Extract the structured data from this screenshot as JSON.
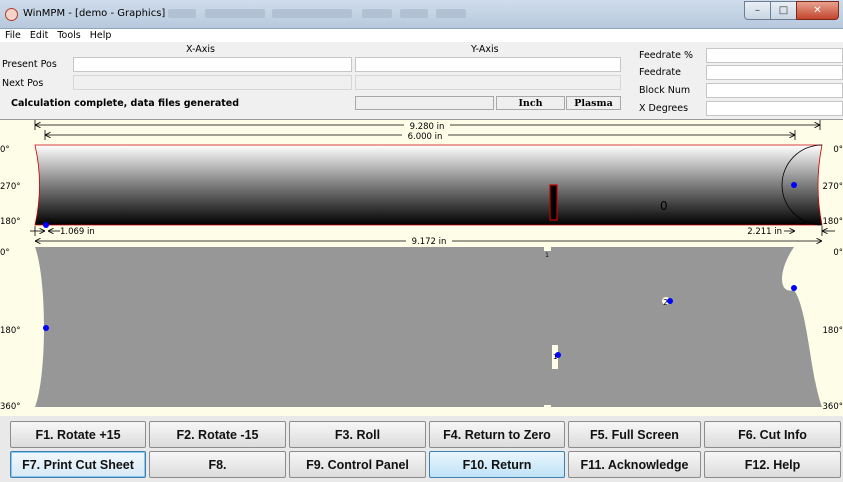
{
  "window": {
    "title": "WinMPM - [demo - Graphics]",
    "icon": "winmpm-app-icon",
    "controls": {
      "minimize": "–",
      "maximize": "□",
      "close": "✕"
    }
  },
  "menu": [
    "File",
    "Edit",
    "Tools",
    "Help"
  ],
  "position_panel": {
    "x_axis_label": "X-Axis",
    "y_axis_label": "Y-Axis",
    "present_pos_label": "Present Pos",
    "next_pos_label": "Next Pos",
    "present_pos_x": "",
    "present_pos_y": "",
    "next_pos_x": "",
    "next_pos_y": ""
  },
  "status": {
    "message": "Calculation complete, data files generated",
    "units": "Inch",
    "process": "Plasma"
  },
  "side_panel": {
    "feedrate_pct_label": "Feedrate %",
    "feedrate_label": "Feedrate",
    "block_num_label": "Block Num",
    "x_degrees_label": "X Degrees",
    "feedrate_pct_value": "",
    "feedrate_value": "",
    "block_num_value": "",
    "x_degrees_value": ""
  },
  "graphics": {
    "dim_overall_top": "9.280 in",
    "dim_length_top": "6.000 in",
    "dim_left_offset": "1.069 in",
    "dim_right_offset": "2.211 in",
    "dim_overall_bottom": "9.172 in",
    "top_view": {
      "angle_0": "0°",
      "angle_270": "270°",
      "angle_180": "180°",
      "angle_0_right": "0°",
      "angle_270_right": "270°",
      "angle_180_right": "180°",
      "hole_label": "0"
    },
    "flat_view": {
      "angle_0": "0°",
      "angle_180": "180°",
      "angle_360": "360°",
      "angle_0_right": "0°",
      "angle_180_right": "180°",
      "angle_360_right": "360°",
      "cut_label_top": "1",
      "cut_label_slot": "1",
      "cut_label_hole": "2"
    },
    "colors": {
      "background": "#fefde8",
      "pipe_gradient_top": "#ffffff",
      "pipe_gradient_bottom": "#000000",
      "flat_fill": "#979797",
      "pierce_point": "#0000ff",
      "cut_slot": "#cc0000"
    }
  },
  "function_keys": [
    {
      "label": "F1. Rotate +15"
    },
    {
      "label": "F2. Rotate -15"
    },
    {
      "label": "F3. Roll"
    },
    {
      "label": "F4. Return to Zero"
    },
    {
      "label": "F5. Full Screen"
    },
    {
      "label": "F6. Cut Info"
    },
    {
      "label": "F7. Print Cut Sheet"
    },
    {
      "label": "F8."
    },
    {
      "label": "F9. Control Panel"
    },
    {
      "label": "F10. Return"
    },
    {
      "label": "F11. Acknowledge"
    },
    {
      "label": "F12. Help"
    }
  ]
}
